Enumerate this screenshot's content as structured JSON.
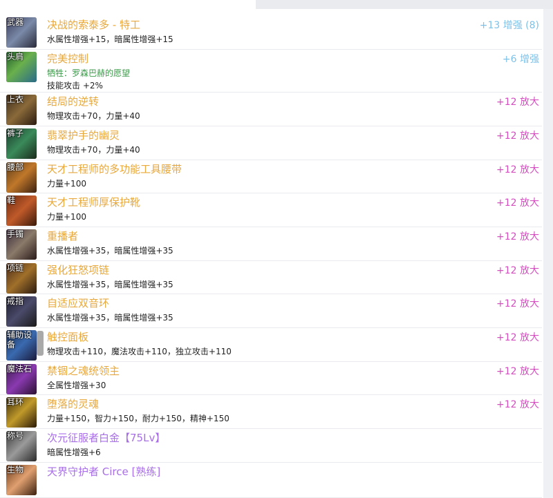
{
  "equipment": [
    {
      "slot": "武器",
      "name": "决战的索泰多 - 特工",
      "name_color": "gold",
      "stats": [
        "水属性增强+15，暗属性增强+15"
      ],
      "enhance": "+13 增强 (8)",
      "enhance_color": "blue",
      "icon": "weapon-icon"
    },
    {
      "slot": "头肩",
      "name": "完美控制",
      "name_color": "gold",
      "stats": [
        "牺牲：罗森巴赫的愿望",
        "技能攻击 +2%"
      ],
      "stat_colors": [
        "green",
        "normal"
      ],
      "enhance": "+6 增强",
      "enhance_color": "blue",
      "icon": "shoulder-icon"
    },
    {
      "slot": "上衣",
      "name": "结局的逆转",
      "name_color": "gold",
      "stats": [
        "物理攻击+70，力量+40"
      ],
      "enhance": "+12 放大",
      "enhance_color": "pink",
      "icon": "top-icon"
    },
    {
      "slot": "裤子",
      "name": "翡翠护手的幽灵",
      "name_color": "gold",
      "stats": [
        "物理攻击+70，力量+40"
      ],
      "enhance": "+12 放大",
      "enhance_color": "pink",
      "icon": "pants-icon"
    },
    {
      "slot": "腰部",
      "name": "天才工程师的多功能工具腰带",
      "name_color": "gold",
      "stats": [
        "力量+100"
      ],
      "enhance": "+12 放大",
      "enhance_color": "pink",
      "icon": "belt-icon"
    },
    {
      "slot": "鞋",
      "name": "天才工程师厚保护靴",
      "name_color": "gold",
      "stats": [
        "力量+100"
      ],
      "enhance": "+12 放大",
      "enhance_color": "pink",
      "icon": "boots-icon"
    },
    {
      "slot": "手镯",
      "name": "重播者",
      "name_color": "gold",
      "stats": [
        "水属性增强+35，暗属性增强+35"
      ],
      "enhance": "+12 放大",
      "enhance_color": "pink",
      "icon": "bracelet-icon"
    },
    {
      "slot": "项链",
      "name": "强化狂怒项链",
      "name_color": "gold",
      "stats": [
        "水属性增强+35，暗属性增强+35"
      ],
      "enhance": "+12 放大",
      "enhance_color": "pink",
      "icon": "necklace-icon"
    },
    {
      "slot": "戒指",
      "name": "自适应双音环",
      "name_color": "gold",
      "stats": [
        "水属性增强+35，暗属性增强+35"
      ],
      "enhance": "+12 放大",
      "enhance_color": "pink",
      "icon": "ring-icon"
    },
    {
      "slot": "辅助设\n备",
      "name": "触控面板",
      "name_color": "gold",
      "stats": [
        "物理攻击+110，魔法攻击+110，独立攻击+110"
      ],
      "enhance": "+12 放大",
      "enhance_color": "pink",
      "icon": "support-equipment-icon"
    },
    {
      "slot": "魔法石",
      "name": "禁锢之魂统领主",
      "name_color": "gold",
      "stats": [
        "全属性增强+30"
      ],
      "enhance": "+12 放大",
      "enhance_color": "pink",
      "icon": "magic-stone-icon"
    },
    {
      "slot": "耳环",
      "name": "堕落的灵魂",
      "name_color": "gold",
      "stats": [
        "力量+150，智力+150，耐力+150，精神+150"
      ],
      "enhance": "+12 放大",
      "enhance_color": "pink",
      "icon": "earring-icon"
    },
    {
      "slot": "称号",
      "name": "次元征服者白金【75Lv】",
      "name_color": "purple",
      "stats": [
        "暗属性增强+6"
      ],
      "enhance": "",
      "enhance_color": "pink",
      "icon": "title-icon"
    },
    {
      "slot": "生物",
      "name": "天界守护者 Circe [熟练]",
      "name_color": "purple",
      "stats": [],
      "enhance": "",
      "enhance_color": "pink",
      "icon": "creature-icon"
    }
  ],
  "colors": {
    "gold": "#e8a83c",
    "purple": "#a86ee8",
    "blue": "#7ec1e8",
    "pink": "#d44ec0",
    "green": "#3c9a4a"
  }
}
